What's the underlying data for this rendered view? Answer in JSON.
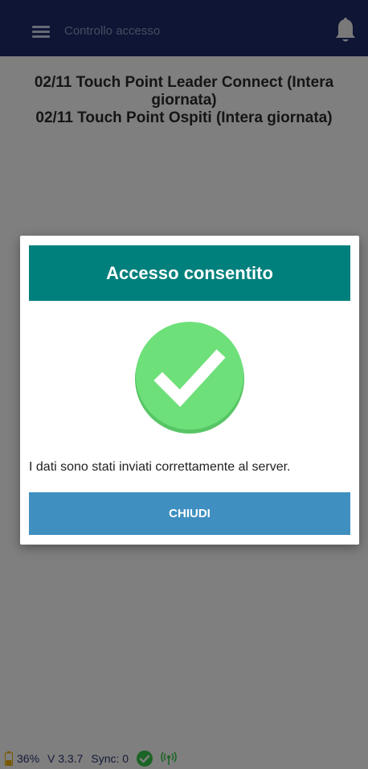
{
  "header": {
    "title": "Controllo accesso",
    "menu_icon": "menu-icon",
    "notification_icon": "bell-icon"
  },
  "main": {
    "events": [
      "02/11 Touch Point Leader Connect (Intera giornata)",
      "02/11 Touch Point Ospiti (Intera giornata)"
    ]
  },
  "dialog": {
    "title": "Accesso consentito",
    "icon": "checkmark-icon",
    "message": "I dati sono stati inviati correttamente al server.",
    "close_label": "CHIUDI"
  },
  "status_bar": {
    "battery": "36%",
    "version": "V 3.3.7",
    "sync": "Sync: 0",
    "sync_ok_icon": "check-circle-icon",
    "signal_icon": "signal-icon"
  },
  "colors": {
    "header": "#1c2a6b",
    "dialog_header": "#00807c",
    "success": "#6ee07a",
    "button": "#3f8fc0"
  }
}
